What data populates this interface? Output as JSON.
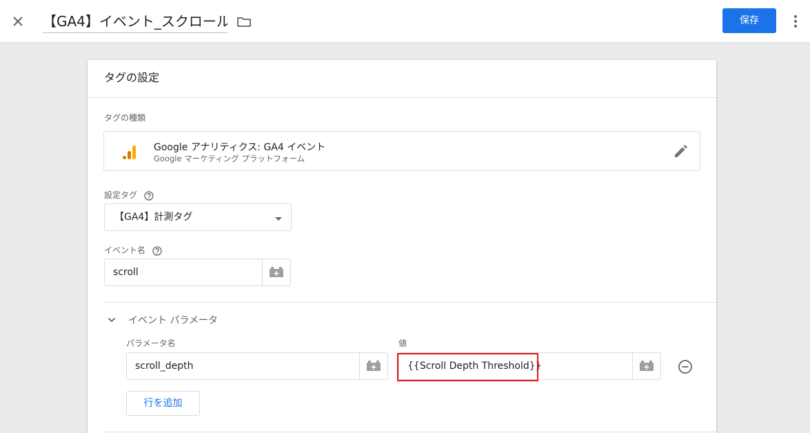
{
  "topbar": {
    "tag_name": "【GA4】イベント_スクロール",
    "save_label": "保存"
  },
  "card": {
    "header_title": "タグの設定",
    "tag_type": {
      "label": "タグの種類",
      "name": "Google アナリティクス: GA4 イベント",
      "provider": "Google マーケティング プラットフォーム"
    },
    "config_tag": {
      "label": "設定タグ",
      "selected": "【GA4】計測タグ"
    },
    "event_name": {
      "label": "イベント名",
      "value": "scroll"
    },
    "event_params": {
      "section_title": "イベント パラメータ",
      "col_name_label": "パラメータ名",
      "col_value_label": "値",
      "rows": [
        {
          "name": "scroll_depth",
          "value": "{{Scroll Depth Threshold}}"
        }
      ],
      "add_row_label": "行を追加"
    }
  },
  "colors": {
    "primary": "#1a73e8",
    "highlight": "#e31313",
    "ga_orange": "#f9ab00",
    "ga_dark_orange": "#e37400"
  }
}
